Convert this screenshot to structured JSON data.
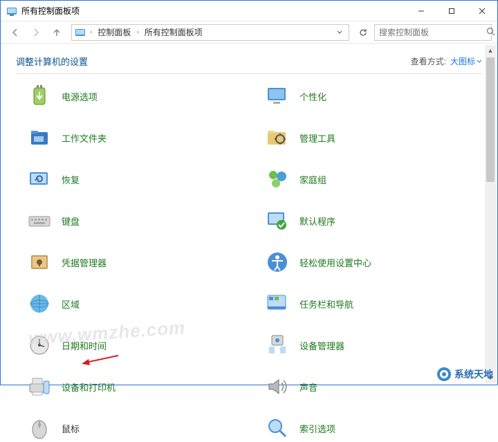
{
  "window": {
    "title": "所有控制面板项"
  },
  "nav": {
    "breadcrumb": [
      "控制面板",
      "所有控制面板项"
    ],
    "search_placeholder": "搜索控制面板"
  },
  "heading": "调整计算机的设置",
  "viewby": {
    "label": "查看方式:",
    "value": "大图标"
  },
  "items": {
    "left": [
      {
        "icon": "power-icon",
        "label": "电源选项"
      },
      {
        "icon": "folder-icon",
        "label": "工作文件夹"
      },
      {
        "icon": "recovery-icon",
        "label": "恢复"
      },
      {
        "icon": "keyboard-icon",
        "label": "键盘"
      },
      {
        "icon": "credential-icon",
        "label": "凭据管理器"
      },
      {
        "icon": "region-icon",
        "label": "区域"
      },
      {
        "icon": "datetime-icon",
        "label": "日期和时间"
      },
      {
        "icon": "devices-icon",
        "label": "设备和打印机"
      },
      {
        "icon": "mouse-icon",
        "label": "鼠标"
      }
    ],
    "right": [
      {
        "icon": "personalize-icon",
        "label": "个性化"
      },
      {
        "icon": "admintools-icon",
        "label": "管理工具"
      },
      {
        "icon": "homegroup-icon",
        "label": "家庭组"
      },
      {
        "icon": "defaultprograms-icon",
        "label": "默认程序"
      },
      {
        "icon": "easeofaccess-icon",
        "label": "轻松使用设置中心"
      },
      {
        "icon": "taskbar-icon",
        "label": "任务栏和导航"
      },
      {
        "icon": "devicemgr-icon",
        "label": "设备管理器"
      },
      {
        "icon": "sound-icon",
        "label": "声音"
      },
      {
        "icon": "indexing-icon",
        "label": "索引选项"
      }
    ]
  },
  "watermark": "www.wmzhe.com",
  "brand": "系统天地"
}
